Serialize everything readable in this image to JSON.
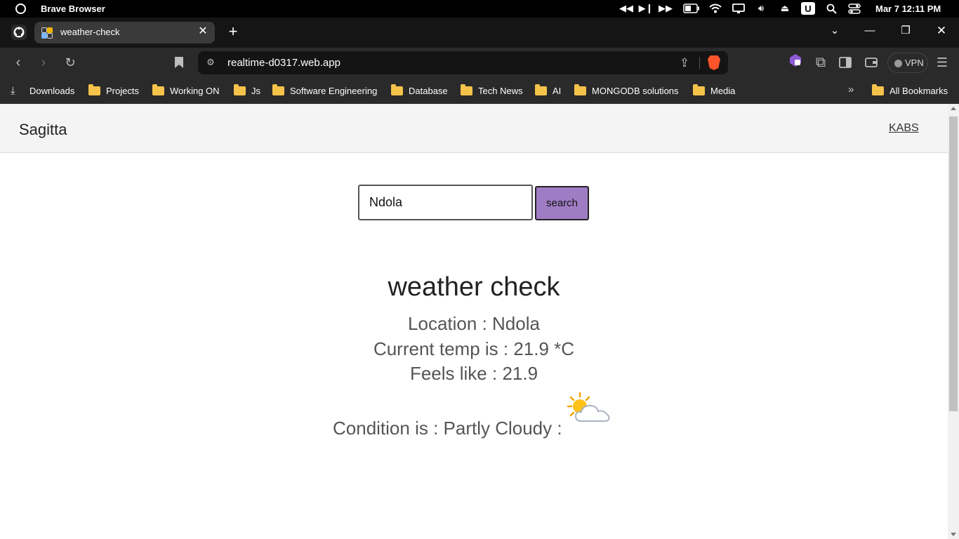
{
  "os": {
    "app_name": "Brave Browser",
    "clock": "Mar 7  12:11 PM",
    "tray_icons": [
      "rewind-icon",
      "play-pause-icon",
      "fast-forward-icon",
      "battery-icon",
      "wifi-icon",
      "display-icon",
      "volume-icon",
      "eject-icon",
      "u-app-icon",
      "search-icon",
      "toggles-icon"
    ]
  },
  "tab": {
    "title": "weather-check",
    "close": "✕",
    "new": "+"
  },
  "window": {
    "dropdown": "⌄",
    "minimize": "—",
    "restore": "❐",
    "close": "✕"
  },
  "toolbar": {
    "url": "realtime-d0317.web.app",
    "vpn_label": "VPN"
  },
  "bookmarks": {
    "items": [
      "Downloads",
      "Projects",
      "Working ON",
      "Js",
      "Software Engineering",
      "Database",
      "Tech News",
      "AI",
      "MONGODB solutions",
      "Media"
    ],
    "more": "»",
    "all": "All Bookmarks"
  },
  "site": {
    "brand": "Sagitta",
    "nav_link": "KABS"
  },
  "search": {
    "value": "Ndola",
    "button_label": "search"
  },
  "weather": {
    "title": "weather check",
    "location_line": "Location : Ndola",
    "temp_line": "Current temp is : 21.9 *C",
    "feels_line": "Feels like : 21.9",
    "condition_line": "Condition is : Partly Cloudy :",
    "condition_icon": "partly-cloudy-icon"
  },
  "colors": {
    "search_button": "#a07cc5",
    "brave_orange": "#fb542b",
    "folder": "#f6c34a"
  }
}
